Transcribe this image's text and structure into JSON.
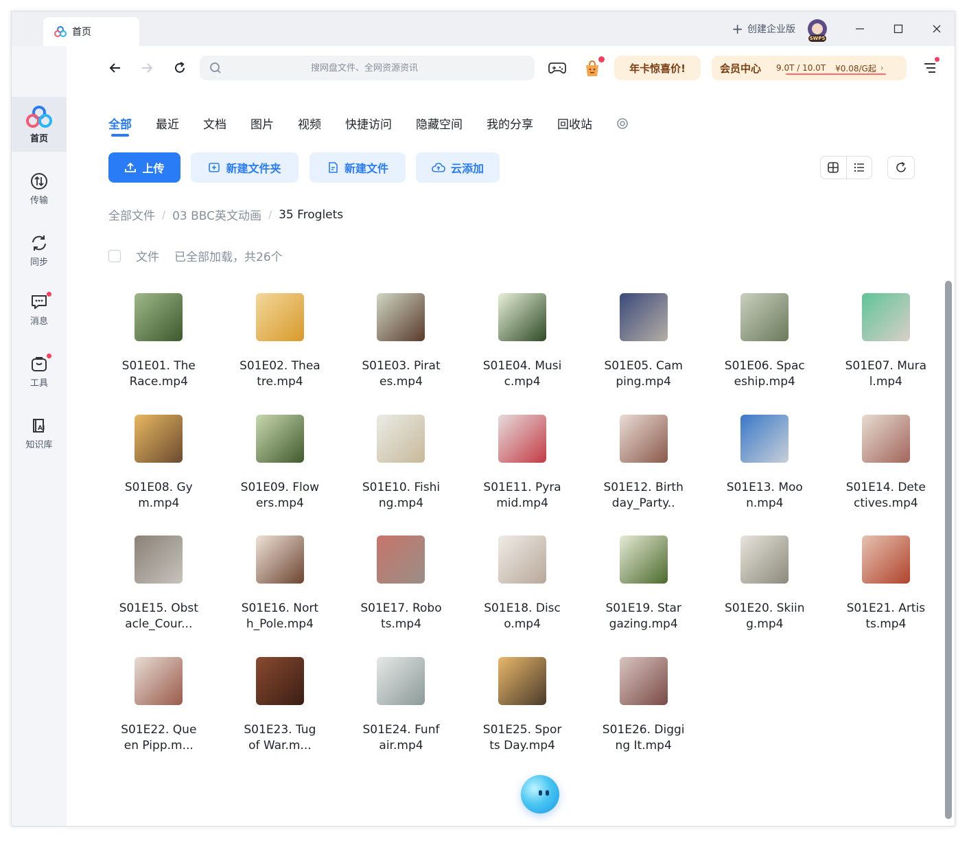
{
  "titlebar": {
    "tab_title": "首页",
    "enterprise_label": "创建企业版",
    "svip_badge": "SWP5"
  },
  "sidebar": {
    "items": [
      {
        "label": "首页",
        "icon": "baidu-cloud-logo-icon",
        "active": true
      },
      {
        "label": "传输",
        "icon": "transfer-icon",
        "badge": false
      },
      {
        "label": "同步",
        "icon": "sync-icon",
        "badge": false
      },
      {
        "label": "消息",
        "icon": "message-icon",
        "badge": true
      },
      {
        "label": "工具",
        "icon": "toolbox-icon",
        "badge": true
      },
      {
        "label": "知识库",
        "icon": "knowledge-base-icon",
        "badge": false
      }
    ]
  },
  "search": {
    "placeholder": "搜网盘文件、全网资源资讯"
  },
  "promo": {
    "label": "年卡惊喜价!"
  },
  "vip": {
    "title": "会员中心",
    "storage": "9.0T / 10.0T",
    "price": "¥0.08/G起"
  },
  "categories": [
    "全部",
    "最近",
    "文档",
    "图片",
    "视频",
    "快捷访问",
    "隐藏空间",
    "我的分享",
    "回收站"
  ],
  "actions": {
    "upload": "上传",
    "new_folder": "新建文件夹",
    "new_file": "新建文件",
    "cloud_add": "云添加"
  },
  "breadcrumb": [
    "全部文件",
    "03 BBC英文动画",
    "35 Froglets"
  ],
  "list_header": {
    "label": "文件",
    "status": "已全部加载，共26个"
  },
  "colors": {
    "accent": "#2a7cf6",
    "vip_text": "#7a3d12",
    "vip_bg": "#fdf1de",
    "badge": "#f53f5f"
  },
  "files": [
    {
      "name": "S01E01. The Race.mp4",
      "thumb": [
        "#3d5a2c",
        "#9fb88a"
      ]
    },
    {
      "name": "S01E02. Theatre.mp4",
      "thumb": [
        "#d89a2a",
        "#f2d79c"
      ]
    },
    {
      "name": "S01E03. Pirates.mp4",
      "thumb": [
        "#5a3a2a",
        "#cfd6c4"
      ]
    },
    {
      "name": "S01E04. Music.mp4",
      "thumb": [
        "#2f4a26",
        "#e6f0d8"
      ]
    },
    {
      "name": "S01E05. Camping.mp4",
      "thumb": [
        "#b6aea6",
        "#3a4a7a"
      ]
    },
    {
      "name": "S01E06. Spaceship.mp4",
      "thumb": [
        "#6b7a5a",
        "#c9cfc0"
      ]
    },
    {
      "name": "S01E07. Mural.mp4",
      "thumb": [
        "#d9cfc8",
        "#5fc497"
      ]
    },
    {
      "name": "S01E08. Gym.mp4",
      "thumb": [
        "#6b4a30",
        "#e8b860"
      ]
    },
    {
      "name": "S01E09. Flowers.mp4",
      "thumb": [
        "#3f5a2c",
        "#c9d8b0"
      ]
    },
    {
      "name": "S01E10. Fishing.mp4",
      "thumb": [
        "#c8b89a",
        "#e9ece6"
      ]
    },
    {
      "name": "S01E11. Pyramid.mp4",
      "thumb": [
        "#c33a44",
        "#e6dcdc"
      ]
    },
    {
      "name": "S01E12. Birthday_Party..",
      "thumb": [
        "#8a5a4a",
        "#eadbd6"
      ]
    },
    {
      "name": "S01E13. Moon.mp4",
      "thumb": [
        "#c8d0d8",
        "#3a78c8"
      ]
    },
    {
      "name": "S01E14. Detectives.mp4",
      "thumb": [
        "#a3655a",
        "#e6dcd2"
      ]
    },
    {
      "name": "S01E15. Obstacle_Cour...",
      "thumb": [
        "#c8c2bc",
        "#8a8278"
      ]
    },
    {
      "name": "S01E16. North_Pole.mp4",
      "thumb": [
        "#6b4430",
        "#efe2d8"
      ]
    },
    {
      "name": "S01E17. Robots.mp4",
      "thumb": [
        "#9a8e86",
        "#c7756a"
      ]
    },
    {
      "name": "S01E18. Disco.mp4",
      "thumb": [
        "#b8a89a",
        "#f0ece6"
      ]
    },
    {
      "name": "S01E19. Stargazing.mp4",
      "thumb": [
        "#4a6a2c",
        "#e6ead6"
      ]
    },
    {
      "name": "S01E20. Skiing.mp4",
      "thumb": [
        "#8a8a7a",
        "#e8e4dc"
      ]
    },
    {
      "name": "S01E21. Artists.mp4",
      "thumb": [
        "#b0432c",
        "#e6c2b2"
      ]
    },
    {
      "name": "S01E22. Queen Pipp.m...",
      "thumb": [
        "#9a5a4a",
        "#e6dcd4"
      ]
    },
    {
      "name": "S01E23. Tug of War.m...",
      "thumb": [
        "#3a1e14",
        "#8a4a30"
      ]
    },
    {
      "name": "S01E24. Funfair.mp4",
      "thumb": [
        "#8a9a98",
        "#e6e8e6"
      ]
    },
    {
      "name": "S01E25. Sports Day.mp4",
      "thumb": [
        "#4a3a2a",
        "#e9b86a"
      ]
    },
    {
      "name": "S01E26. Digging It.mp4",
      "thumb": [
        "#7a4a46",
        "#d8c4c0"
      ]
    }
  ]
}
